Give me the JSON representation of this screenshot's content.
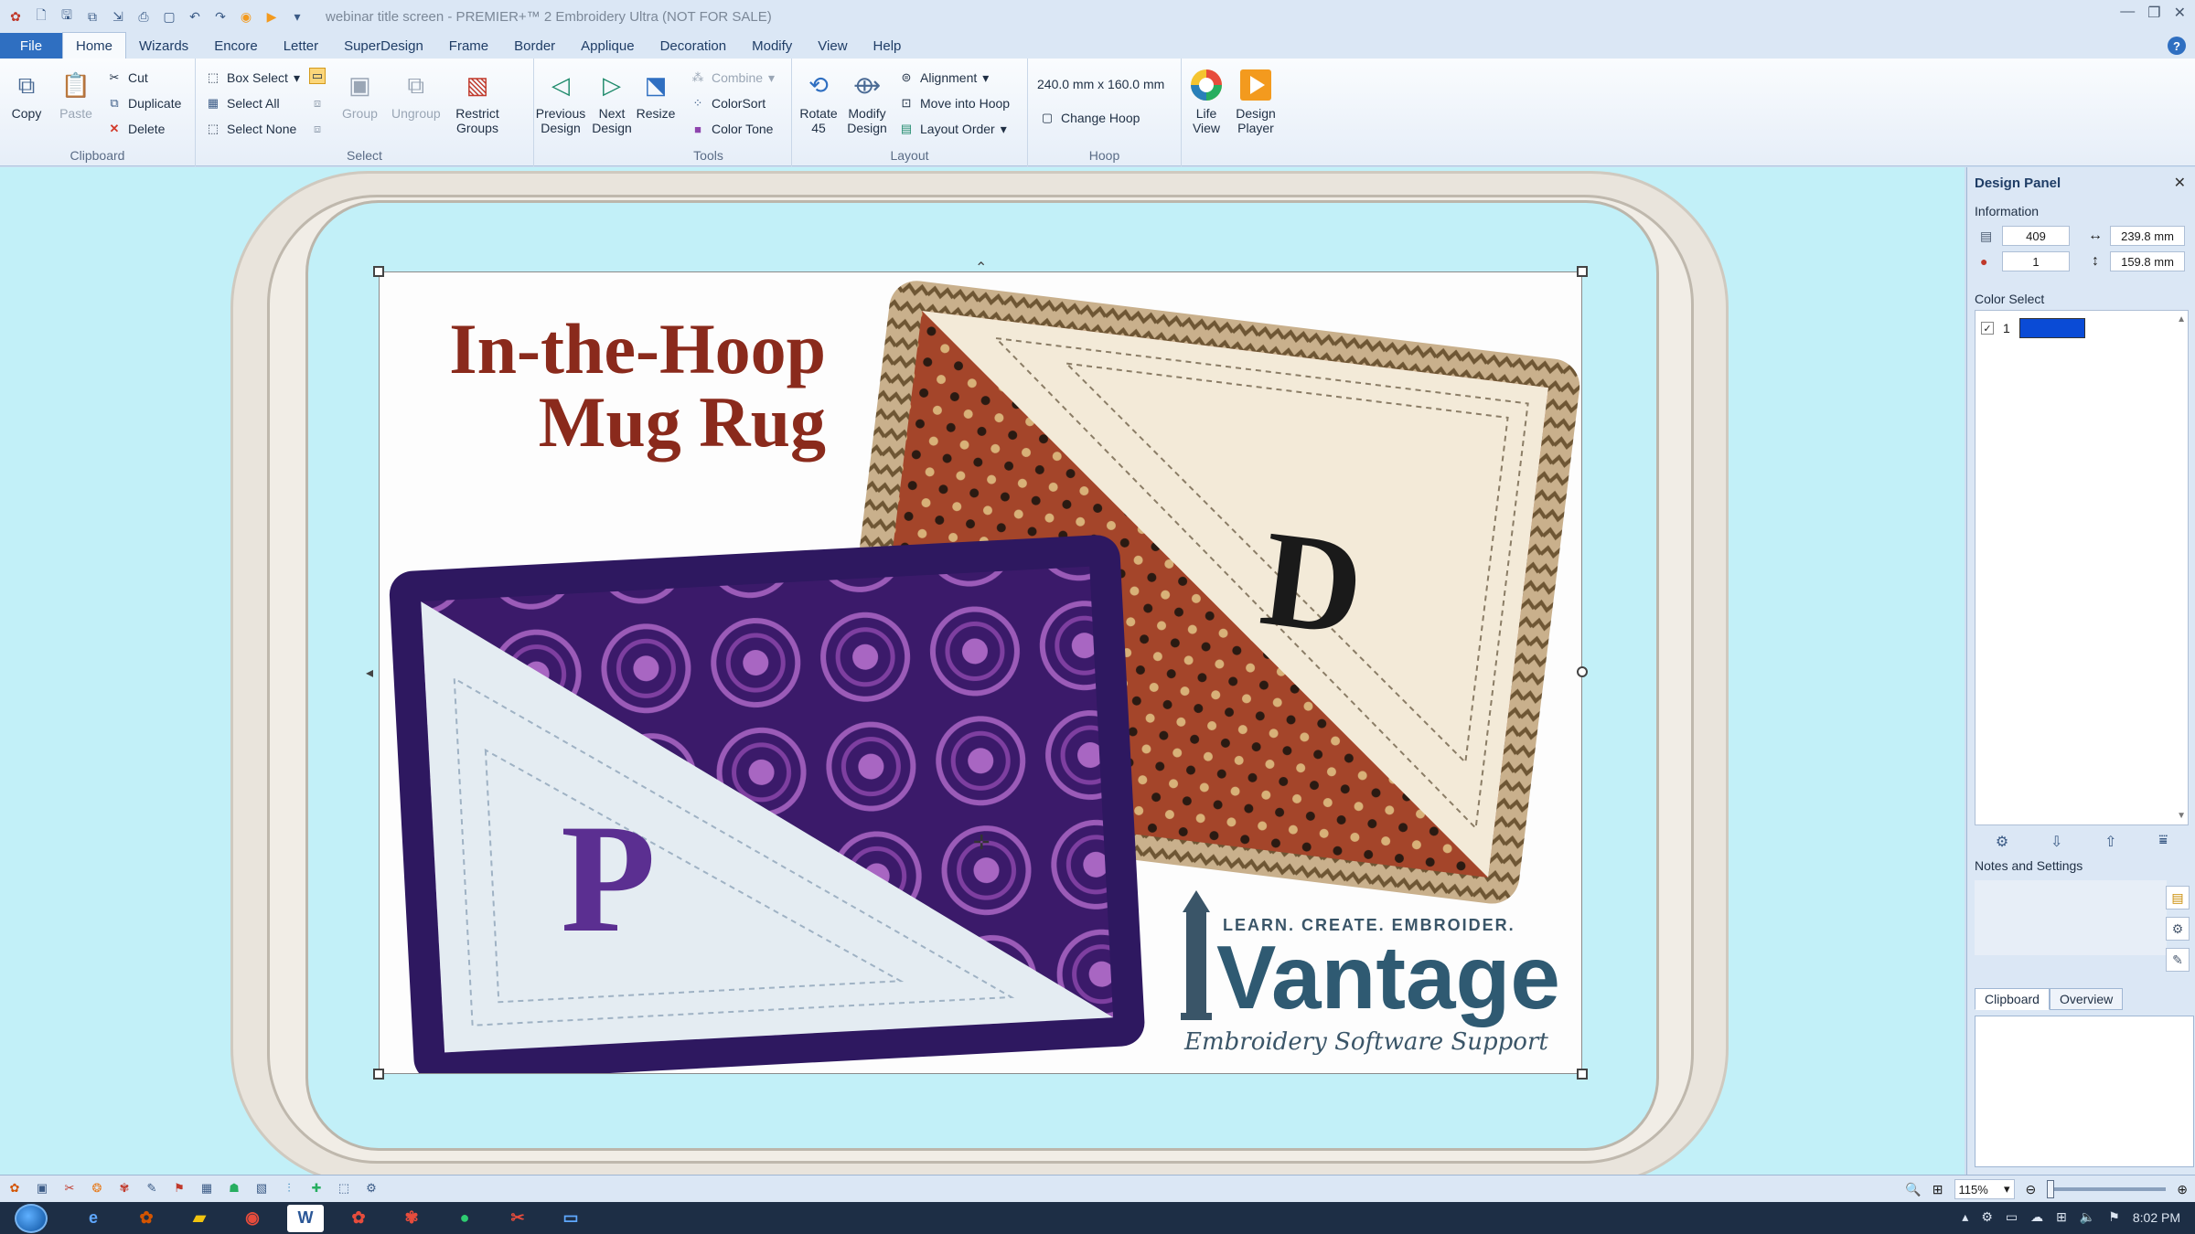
{
  "window": {
    "title": "webinar title screen - PREMIER+™ 2 Embroidery Ultra (NOT FOR SALE)",
    "controls": [
      "—",
      "❐",
      "✕"
    ]
  },
  "tabs": [
    "File",
    "Home",
    "Wizards",
    "Encore",
    "Letter",
    "SuperDesign",
    "Frame",
    "Border",
    "Applique",
    "Decoration",
    "Modify",
    "View",
    "Help"
  ],
  "ribbon": {
    "clipboard": {
      "label": "Clipboard",
      "copy": "Copy",
      "paste": "Paste",
      "cut": "Cut",
      "duplicate": "Duplicate",
      "delete": "Delete"
    },
    "select": {
      "label": "Select",
      "box_select": "Box Select",
      "select_all": "Select All",
      "select_none": "Select None",
      "group": "Group",
      "ungroup": "Ungroup",
      "restrict_groups": "Restrict Groups"
    },
    "design_nav": {
      "previous": "Previous Design",
      "next": "Next Design"
    },
    "tools": {
      "label": "Tools",
      "resize": "Resize",
      "combine": "Combine",
      "colorsort": "ColorSort",
      "color_tone": "Color Tone"
    },
    "layout": {
      "label": "Layout",
      "rotate": "Rotate 45",
      "modify": "Modify Design",
      "alignment": "Alignment",
      "move_into_hoop": "Move into Hoop",
      "layout_order": "Layout Order"
    },
    "hoop": {
      "label": "Hoop",
      "size": "240.0 mm x 160.0 mm",
      "change_hoop": "Change Hoop"
    },
    "life_view": "Life View",
    "design_player": "Design Player"
  },
  "design": {
    "title_line1": "In-the-Hoop",
    "title_line2": "Mug Rug",
    "letter_d": "D",
    "letter_p": "P",
    "brand_tagline": "LEARN. CREATE. EMBROIDER.",
    "brand_name": "Vantage",
    "brand_sub": "Embroidery Software Support"
  },
  "panel": {
    "title": "Design Panel",
    "information_label": "Information",
    "stitches": "409",
    "width": "239.8 mm",
    "colors": "1",
    "height": "159.8 mm",
    "color_select_label": "Color Select",
    "color_index": "1",
    "color_hex": "#0a4bd6",
    "notes_label": "Notes and Settings",
    "tab_clipboard": "Clipboard",
    "tab_overview": "Overview"
  },
  "status": {
    "zoom": "115%",
    "zoom_fraction": 0.0
  },
  "taskbar": {
    "time": "8:02 PM"
  }
}
